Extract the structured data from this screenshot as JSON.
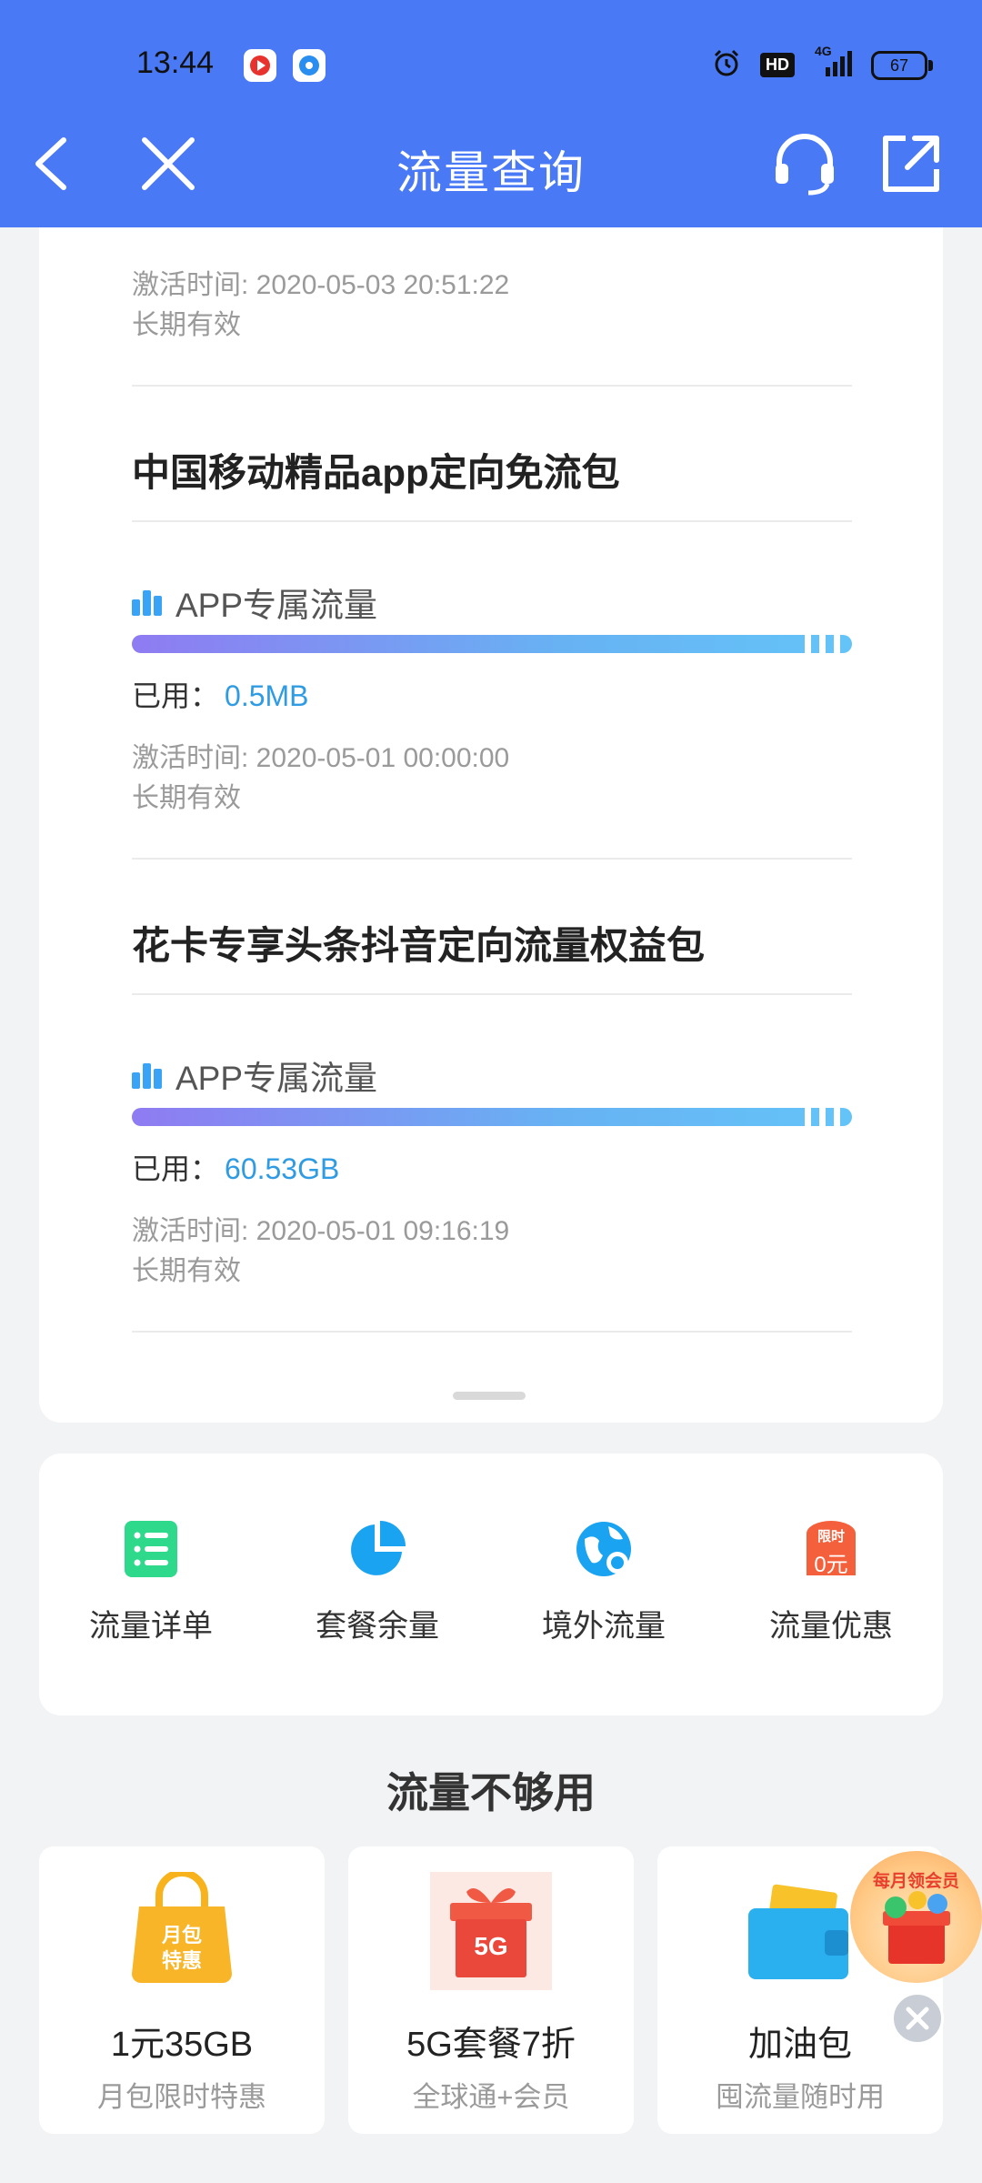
{
  "status_bar": {
    "time": "13:44",
    "signal": "4G",
    "battery": "67"
  },
  "nav": {
    "title": "流量查询"
  },
  "top_partial": {
    "activated": "激活时间: 2020-05-03 20:51:22",
    "validity": "长期有效"
  },
  "packages": [
    {
      "title": "中国移动精品app定向免流包",
      "flow_type": "APP专属流量",
      "used_label": "已用：",
      "used_value": "0.5MB",
      "activated": "激活时间: 2020-05-01 00:00:00",
      "validity": "长期有效"
    },
    {
      "title": "花卡专享头条抖音定向流量权益包",
      "flow_type": "APP专属流量",
      "used_label": "已用：",
      "used_value": "60.53GB",
      "activated": "激活时间: 2020-05-01 09:16:19",
      "validity": "长期有效"
    }
  ],
  "quick_links": [
    {
      "label": "流量详单",
      "icon": "list-icon",
      "color": "#2fd98b"
    },
    {
      "label": "套餐余量",
      "icon": "pie-chart-icon",
      "color": "#1aa3f0"
    },
    {
      "label": "境外流量",
      "icon": "globe-icon",
      "color": "#1aa3f0"
    },
    {
      "label": "流量优惠",
      "icon": "discount-tag-icon",
      "color": "#f5603c",
      "tag_top": "限时",
      "tag_bottom": "0元"
    }
  ],
  "section_title": "流量不够用",
  "promos": [
    {
      "title": "1元35GB",
      "subtitle": "月包限时特惠",
      "badge_line1": "月包",
      "badge_line2": "特惠"
    },
    {
      "title": "5G套餐7折",
      "subtitle": "全球通+会员",
      "badge": "5G"
    },
    {
      "title": "加油包",
      "subtitle": "囤流量随时用"
    }
  ],
  "floating": {
    "text": "每月领会员"
  },
  "colors": {
    "header": "#4a79f5",
    "accent": "#2f9be3",
    "progress_start": "#8f7bf2",
    "progress_end": "#64c4f8"
  }
}
